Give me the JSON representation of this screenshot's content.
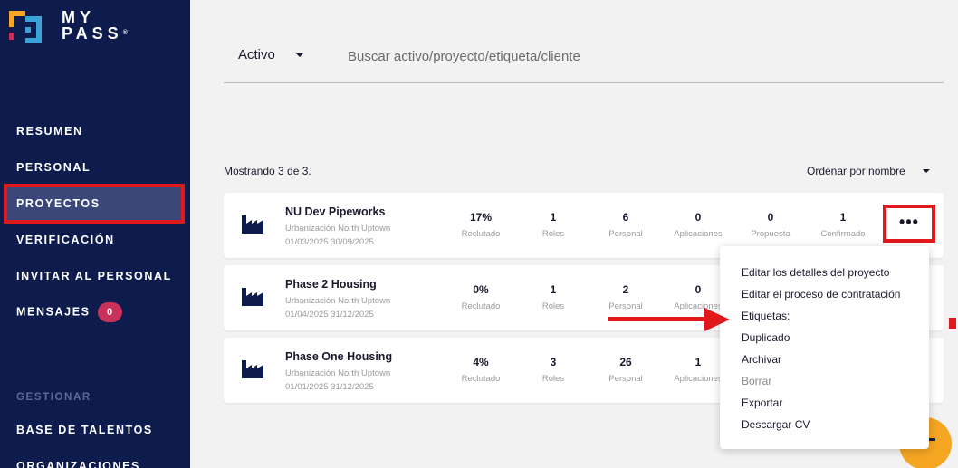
{
  "sidebar": {
    "logo": {
      "line1": "MY",
      "line2": "PASS",
      "reg": "®",
      "mark_colors": [
        "#f5a623",
        "#c8325a",
        "#3aa3d8"
      ]
    },
    "nav": [
      {
        "label": "RESUMEN"
      },
      {
        "label": "PERSONAL"
      },
      {
        "label": "PROYECTOS",
        "active": true
      },
      {
        "label": "VERIFICACIÓN"
      },
      {
        "label": "INVITAR AL PERSONAL"
      },
      {
        "label": "MENSAJES",
        "badge": "0"
      }
    ],
    "section_label": "GESTIONAR",
    "manage": [
      {
        "label": "BASE DE TALENTOS"
      },
      {
        "label": "ORGANIZACIONES"
      }
    ]
  },
  "search": {
    "status_value": "Activo",
    "placeholder": "Buscar activo/proyecto/etiqueta/cliente"
  },
  "list": {
    "count_text": "Mostrando 3 de 3.",
    "sort_label": "Ordenar por nombre"
  },
  "projects": [
    {
      "name": "NU Dev Pipeworks",
      "location": "Urbanización North Uptown",
      "dates": "01/03/2025 30/09/2025",
      "stats": [
        {
          "value": "17%",
          "label": "Reclutado"
        },
        {
          "value": "1",
          "label": "Roles"
        },
        {
          "value": "6",
          "label": "Personal"
        },
        {
          "value": "0",
          "label": "Aplicaciones"
        },
        {
          "value": "0",
          "label": "Propuesta"
        },
        {
          "value": "1",
          "label": "Confirmado"
        }
      ]
    },
    {
      "name": "Phase 2 Housing",
      "location": "Urbanización North Uptown",
      "dates": "01/04/2025 31/12/2025",
      "stats": [
        {
          "value": "0%",
          "label": "Reclutado"
        },
        {
          "value": "1",
          "label": "Roles"
        },
        {
          "value": "2",
          "label": "Personal"
        },
        {
          "value": "0",
          "label": "Aplicaciones"
        }
      ]
    },
    {
      "name": "Phase One Housing",
      "location": "Urbanización North Uptown",
      "dates": "01/01/2025 31/12/2025",
      "stats": [
        {
          "value": "4%",
          "label": "Reclutado"
        },
        {
          "value": "3",
          "label": "Roles"
        },
        {
          "value": "26",
          "label": "Personal"
        },
        {
          "value": "1",
          "label": "Aplicaciones"
        }
      ]
    }
  ],
  "more_button": {
    "label": "•••"
  },
  "context_menu": {
    "items": [
      {
        "label": "Editar los detalles del proyecto"
      },
      {
        "label": "Editar el proceso de contratación"
      },
      {
        "label": "Etiquetas:"
      },
      {
        "label": "Duplicado"
      },
      {
        "label": "Archivar"
      },
      {
        "label": "Borrar",
        "disabled": true
      },
      {
        "label": "Exportar"
      },
      {
        "label": "Descargar CV"
      }
    ]
  },
  "colors": {
    "sidebar_bg": "#0e1b4d",
    "annotation_red": "#e0191c",
    "badge": "#c8325a",
    "fab": "#f5a623"
  },
  "icons": {
    "project": "factory-icon",
    "status_caret": "chevron-down-icon",
    "more": "more-horizontal-icon",
    "fab": "plus-icon"
  }
}
